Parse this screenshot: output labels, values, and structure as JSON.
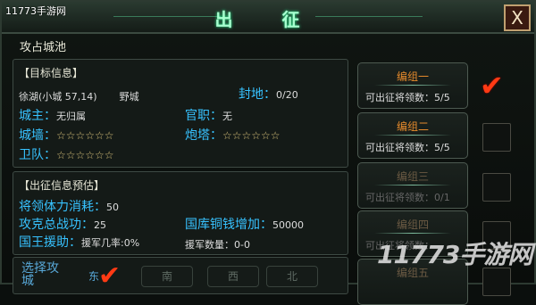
{
  "window": {
    "title": "出 征",
    "watermark_top": "11773手游网",
    "close_label": "X"
  },
  "section_title": "攻占城池",
  "target_info": {
    "header": "【目标信息】",
    "city_name": "徐湖(小城 57,14)",
    "city_type": "野城",
    "fengdi_label": "封地：",
    "fengdi_value": "0/20",
    "owner_label": "城主：",
    "owner_value": "无归属",
    "office_label": "官职：",
    "office_value": "无",
    "wall_label": "城墙：",
    "wall_stars": "☆☆☆☆☆☆",
    "tower_label": "炮塔：",
    "tower_stars": "☆☆☆☆☆☆",
    "guard_label": "卫队：",
    "guard_stars": "☆☆☆☆☆☆"
  },
  "estimate": {
    "header": "【出征信息预估】",
    "stamina_label": "将领体力消耗：",
    "stamina_value": "50",
    "merit_label": "攻克总战功：",
    "merit_value": "25",
    "copper_label": "国库铜钱增加：",
    "copper_value": "50000",
    "aid_label": "国王援助：",
    "aid_rate": "援军几率:0%",
    "aid_count": "援军数量：0-0"
  },
  "direction": {
    "label": "选择攻城",
    "buttons": [
      "东",
      "南",
      "西",
      "北"
    ]
  },
  "groups": [
    {
      "name": "编组一",
      "sub": "可出征将领数：5/5",
      "checked": true,
      "dim": false
    },
    {
      "name": "编组二",
      "sub": "可出征将领数：5/5",
      "checked": false,
      "dim": false
    },
    {
      "name": "编组三",
      "sub": "可出征将领数：0/1",
      "checked": false,
      "dim": true
    },
    {
      "name": "编组四",
      "sub": "可出征将领数：",
      "checked": false,
      "dim": true
    },
    {
      "name": "编组五",
      "sub": "",
      "checked": false,
      "dim": true
    }
  ],
  "watermark": "11773手游网",
  "colors": {
    "accent": "#37c2ff",
    "group_name": "#e58a2c",
    "check": "#ff3a14"
  }
}
